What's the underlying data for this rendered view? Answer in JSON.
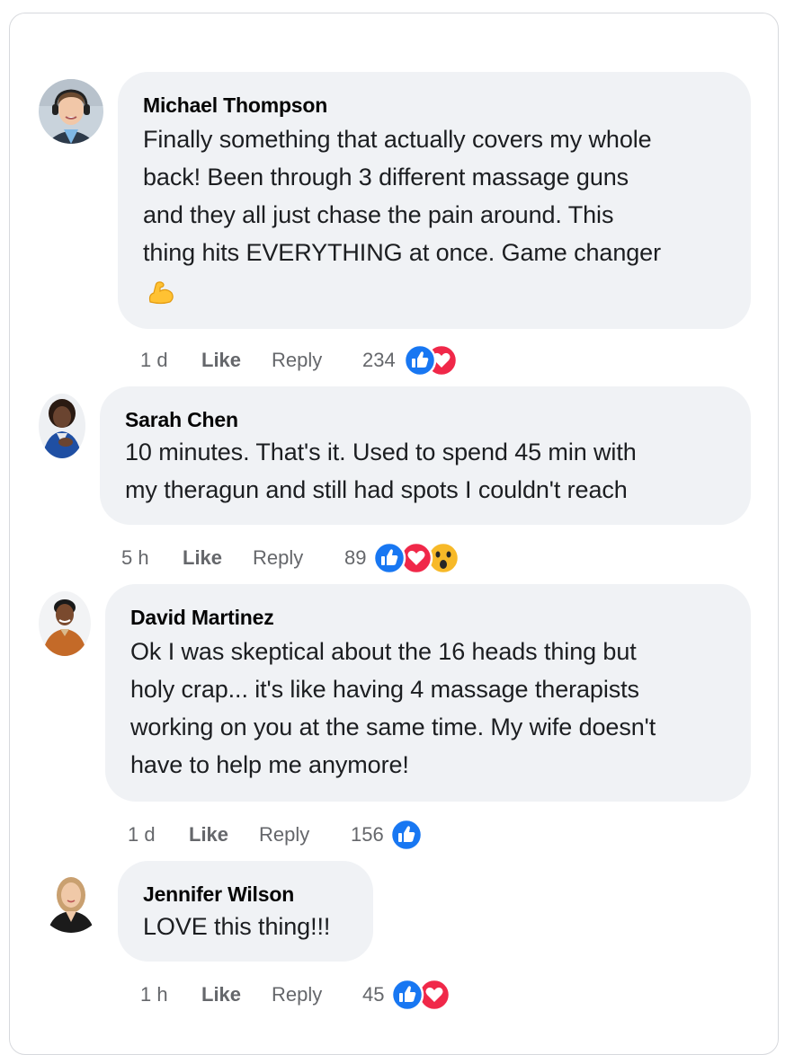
{
  "comments": [
    {
      "author": "Michael Thompson",
      "lines": [
        "Finally something that actually covers my whole",
        "back! Been through 3 different massage guns",
        "and they all just chase the pain around. This",
        "thing hits EVERYTHING at once. Game changer"
      ],
      "emoji": "flexed-biceps",
      "time": "1 d",
      "like_label": "Like",
      "reply_label": "Reply",
      "reaction_count": "234",
      "reactions": [
        "like",
        "love"
      ]
    },
    {
      "author": "Sarah Chen",
      "lines": [
        "10 minutes. That's it. Used to spend 45 min with",
        "my theragun and still had spots I couldn't reach"
      ],
      "time": "5 h",
      "like_label": "Like",
      "reply_label": "Reply",
      "reaction_count": "89",
      "reactions": [
        "like",
        "love",
        "wow"
      ]
    },
    {
      "author": "David Martinez",
      "lines": [
        "Ok I was skeptical about the 16 heads thing but",
        "holy crap... it's like having 4 massage therapists",
        "working on you at the same time. My wife doesn't",
        "have to help me anymore!"
      ],
      "time": "1 d",
      "like_label": "Like",
      "reply_label": "Reply",
      "reaction_count": "156",
      "reactions": [
        "like"
      ]
    },
    {
      "author": "Jennifer Wilson",
      "lines": [
        "LOVE this thing!!!"
      ],
      "time": "1 h",
      "like_label": "Like",
      "reply_label": "Reply",
      "reaction_count": "45",
      "reactions": [
        "like",
        "love"
      ]
    }
  ],
  "colors": {
    "bubble": "#f0f2f5",
    "meta_text": "#65676b",
    "like_blue": "#1877f2",
    "love_red": "#f02849",
    "border": "#d7d9dd"
  }
}
